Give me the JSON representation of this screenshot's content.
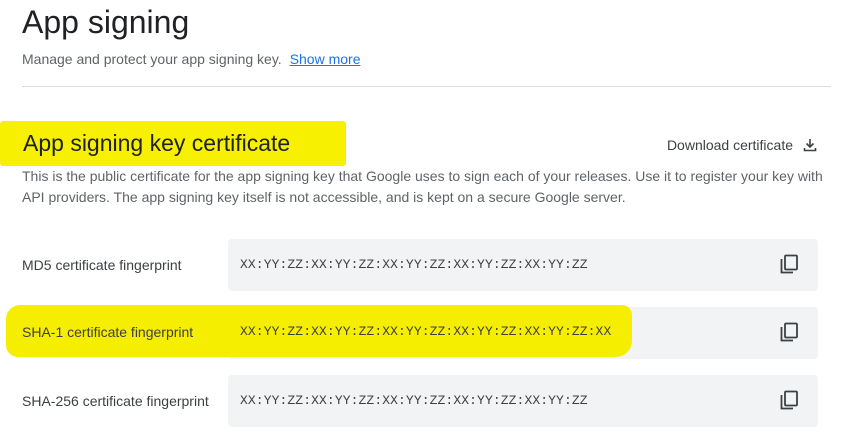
{
  "header": {
    "title": "App signing",
    "subtitle": "Manage and protect your app signing key.",
    "show_more": "Show more"
  },
  "certificate_section": {
    "title": "App signing key certificate",
    "download_label": "Download certificate",
    "description": "This is the public certificate for the app signing key that Google uses to sign each of your releases. Use it to register your key with API providers. The app signing key itself is not accessible, and is kept on a secure Google server.",
    "fingerprints": [
      {
        "label": "MD5 certificate fingerprint",
        "value": "XX:YY:ZZ:XX:YY:ZZ:XX:YY:ZZ:XX:YY:ZZ:XX:YY:ZZ"
      },
      {
        "label": "SHA-1 certificate fingerprint",
        "value": "XX:YY:ZZ:XX:YY:ZZ:XX:YY:ZZ:XX:YY:ZZ:XX:YY:ZZ:XX"
      },
      {
        "label": "SHA-256 certificate fingerprint",
        "value": "XX:YY:ZZ:XX:YY:ZZ:XX:YY:ZZ:XX:YY:ZZ:XX:YY:ZZ"
      }
    ]
  },
  "icons": {
    "download": "download-icon",
    "copy": "copy-icon"
  },
  "colors": {
    "highlight": "#f7f000",
    "link": "#1a73e8",
    "field_background": "#f1f3f4"
  }
}
